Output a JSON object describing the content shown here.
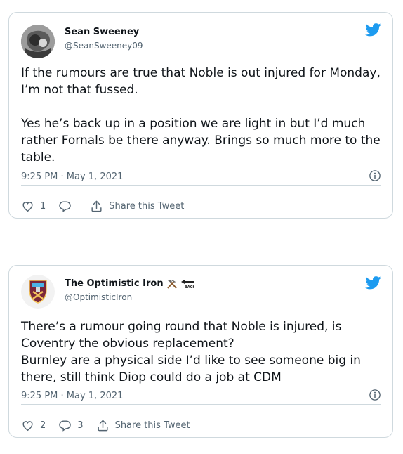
{
  "tweets": [
    {
      "name": "Sean Sweeney",
      "handle": "@SeanSweeney09",
      "text": "If the rumours are true that Noble is out injured for Monday, I’m not that fussed.\n\nYes he’s back up in a position we are light in but I’d much rather Fornals be there anyway. Brings so much more to the table.",
      "timestamp": "9:25 PM · May 1, 2021",
      "likes": "1",
      "replies": "",
      "share_label": "Share this Tweet",
      "avatar_icon": "profile-photo"
    },
    {
      "name": "The Optimistic Iron",
      "name_emoji": "hammer-and-pick-icon",
      "name_emoji2": "back-arrow-icon",
      "handle": "@OptimisticIron",
      "text": "There’s a rumour going round that Noble is injured, is Coventry the obvious replacement?\nBurnley are a physical side I’d like to see someone big in there, still think Diop could do a job at CDM",
      "timestamp": "9:25 PM · May 1, 2021",
      "likes": "2",
      "replies": "3",
      "share_label": "Share this Tweet",
      "avatar_icon": "west-ham-crest"
    }
  ],
  "colors": {
    "twitter_blue": "#1d9bf0",
    "text": "#0f1419",
    "secondary": "#536471",
    "border": "#cfd9de"
  }
}
